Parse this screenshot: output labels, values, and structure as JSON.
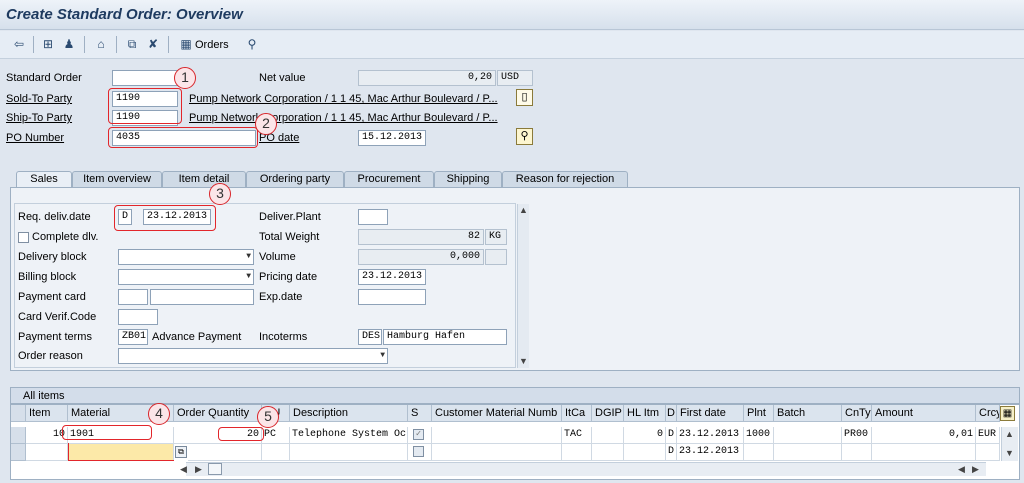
{
  "title": "Create Standard Order: Overview",
  "toolbar": {
    "orders_label": "Orders"
  },
  "header": {
    "standard_order_label": "Standard Order",
    "standard_order_value": "",
    "net_value_label": "Net value",
    "net_value": "0,20",
    "currency": "USD",
    "sold_to_label": "Sold-To Party",
    "sold_to_value": "1190",
    "sold_to_desc": "Pump Network Corporation / 1 1 45, Mac Arthur Boulevard / P...",
    "ship_to_label": "Ship-To Party",
    "ship_to_value": "1190",
    "ship_to_desc": "Pump Network Corporation / 1 1 45, Mac Arthur Boulevard / P...",
    "po_number_label": "PO Number",
    "po_number_value": "4035",
    "po_date_label": "PO date",
    "po_date_value": "15.12.2013"
  },
  "tabs": [
    "Sales",
    "Item overview",
    "Item detail",
    "Ordering party",
    "Procurement",
    "Shipping",
    "Reason for rejection"
  ],
  "sales": {
    "req_deliv_label": "Req. deliv.date",
    "req_deliv_type": "D",
    "req_deliv_value": "23.12.2013",
    "deliver_plant_label": "Deliver.Plant",
    "deliver_plant_value": "",
    "complete_dlv_label": "Complete dlv.",
    "total_weight_label": "Total Weight",
    "total_weight_value": "82",
    "weight_unit": "KG",
    "delivery_block_label": "Delivery block",
    "volume_label": "Volume",
    "volume_value": "0,000",
    "billing_block_label": "Billing block",
    "pricing_date_label": "Pricing date",
    "pricing_date_value": "23.12.2013",
    "payment_card_label": "Payment card",
    "exp_date_label": "Exp.date",
    "card_verif_label": "Card Verif.Code",
    "payment_terms_label": "Payment terms",
    "payment_terms_value": "ZB01",
    "payment_terms_desc": "Advance Payment",
    "incoterms_label": "Incoterms",
    "incoterms_value": "DES",
    "incoterms_desc": "Hamburg Hafen",
    "order_reason_label": "Order reason"
  },
  "items": {
    "title": "All items",
    "columns": [
      "Item",
      "Material",
      "Order Quantity",
      "SU",
      "Description",
      "S",
      "Customer Material Numb",
      "ItCa",
      "DGIP",
      "HL Itm",
      "D",
      "First date",
      "Plnt",
      "Batch",
      "CnTy",
      "Amount",
      "Crcy"
    ],
    "rows": [
      {
        "item": "10",
        "material": "1901",
        "qty": "20",
        "su": "PC",
        "desc": "Telephone System Oc...",
        "itca": "TAC",
        "hl": "0",
        "d": "D",
        "first_date": "23.12.2013",
        "plnt": "1000",
        "cnty": "PR00",
        "amount": "0,01",
        "crcy": "EUR"
      },
      {
        "item": "",
        "material": "",
        "qty": "",
        "su": "",
        "desc": "",
        "itca": "",
        "hl": "",
        "d": "D",
        "first_date": "23.12.2013",
        "plnt": "",
        "cnty": "",
        "amount": "",
        "crcy": ""
      }
    ]
  },
  "callouts": [
    "1",
    "2",
    "3",
    "4",
    "5"
  ]
}
